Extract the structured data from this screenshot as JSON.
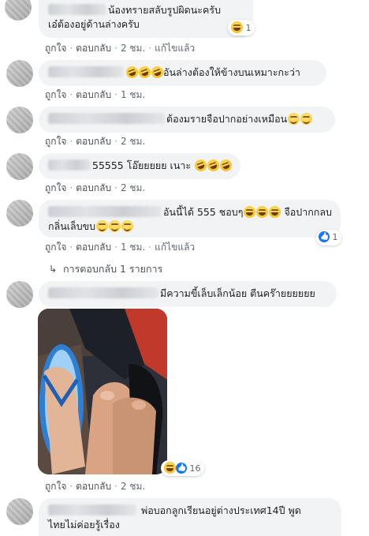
{
  "actions": {
    "like": "ถูกใจ",
    "reply": "ตอบกลับ",
    "edited": "แก้ไขแล้ว"
  },
  "comments": [
    {
      "text_line1": "น้องทรายสลับรูปผิดนะครับ",
      "text_line2": "เอ๋ต้องอยู่ด้านล่างครับ",
      "time": "2 ชม.",
      "edited": true,
      "reaction_count": "1"
    },
    {
      "text": "อันล่างต้องให้ข้างบนเหมาะกะว่า",
      "time": "1 ชม."
    },
    {
      "text": "ต้องมรายจือปากอย่างเหมือน",
      "time": "2 ชม."
    },
    {
      "text": "55555 โอ๊ยยยยย เนาะ",
      "time": "2 ชม."
    },
    {
      "text_line1": "อันนี้ได้ 555 ชอบๆ",
      "text_line1b": "จือปากกลบ",
      "text_line2": "กลิ่นเล็บขบ",
      "time": "1 ชม.",
      "edited": true,
      "reaction_count": "1",
      "replies": "การตอบกลับ 1 รายการ"
    },
    {
      "text": "มีความขี้เล็บเล็กน้อย ตีนคร๊ายยยยยย",
      "time": "2 ชม.",
      "reaction_count": "16"
    },
    {
      "text_line1": "พ่อบอกลูกเรียนอยู่ต่างประเทศ14ปี พูด",
      "text_line2": "ไทยไม่ค่อยรู้เรื่อง"
    }
  ]
}
